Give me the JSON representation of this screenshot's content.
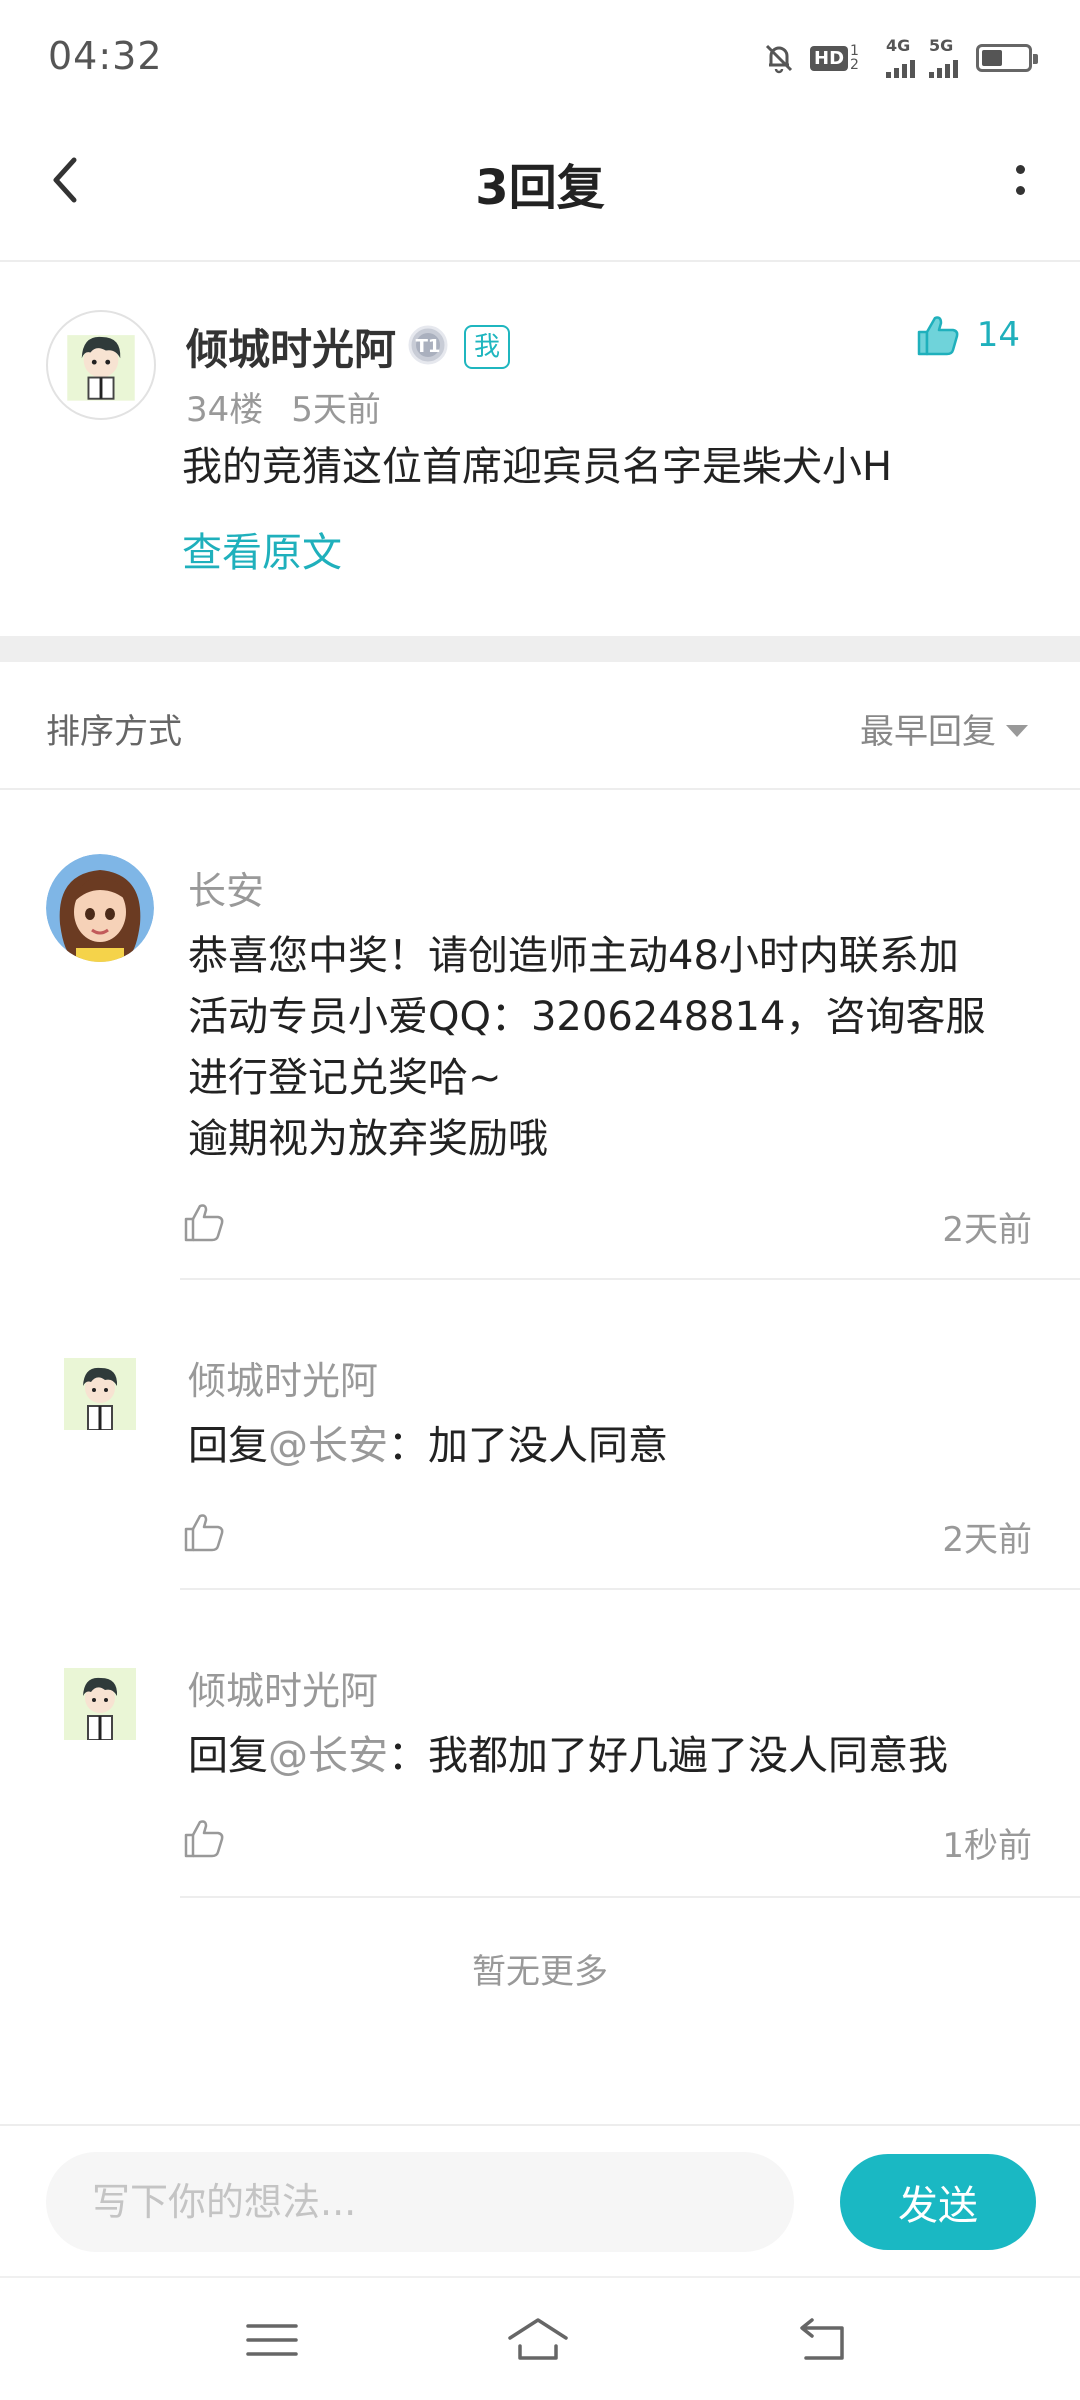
{
  "status_bar": {
    "time": "04:32",
    "hd_label": "HD",
    "hd_sub1": "1",
    "hd_sub2": "2",
    "net1_label": "4G",
    "net2_label": "5G",
    "battery_level": 0.45
  },
  "header": {
    "title": "3回复",
    "icons": {
      "back": "back-arrow-icon",
      "more": "more-vertical-icon"
    }
  },
  "main_post": {
    "username": "倾城时光阿",
    "level_badge": "T1",
    "me_badge": "我",
    "floor": "34楼",
    "time_ago": "5天前",
    "content": "我的竞猜这位首席迎宾员名字是柴犬小H",
    "view_original": "查看原文",
    "like_count": "14"
  },
  "sort": {
    "label": "排序方式",
    "selected": "最早回复"
  },
  "replies": [
    {
      "username": "长安",
      "lines": [
        "恭喜您中奖！请创造师主动48小时内联系加",
        "活动专员小爱QQ：3206248814，咨询客服",
        "进行登记兑奖哈~",
        "逾期视为放弃奖励哦"
      ],
      "time_ago": "2天前"
    },
    {
      "username": "倾城时光阿",
      "reply_prefix": "回复",
      "mention": "@长安",
      "text": "：加了没人同意",
      "time_ago": "2天前"
    },
    {
      "username": "倾城时光阿",
      "reply_prefix": "回复",
      "mention": "@长安",
      "text": "：我都加了好几遍了没人同意我",
      "time_ago": "1秒前"
    }
  ],
  "footer_note": "暂无更多",
  "input_bar": {
    "placeholder": "写下你的想法...",
    "send_label": "发送"
  },
  "colors": {
    "accent": "#1ab8c3",
    "text_primary": "#222222",
    "text_secondary": "#999999"
  }
}
